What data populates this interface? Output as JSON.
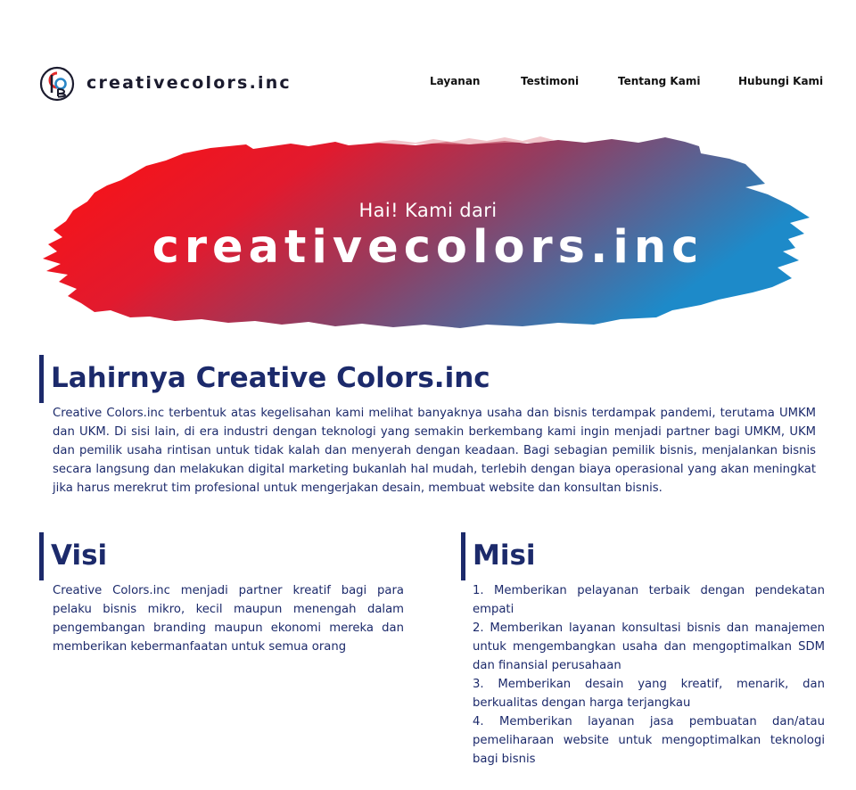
{
  "header": {
    "logo_icon": "creativecolors-logo-icon",
    "brand": "creativecolors.inc",
    "nav": [
      "Layanan",
      "Testimoni",
      "Tentang Kami",
      "Hubungi Kami"
    ]
  },
  "hero": {
    "subtitle": "Hai! Kami dari",
    "title": "creativecolors.inc",
    "gradient": [
      "#ff1010",
      "#1d8ac9"
    ]
  },
  "about": {
    "heading": "Lahirnya Creative Colors.inc",
    "body": "Creative Colors.inc terbentuk atas kegelisahan kami melihat banyaknya usaha dan bisnis terdampak pandemi, terutama UMKM dan UKM. Di sisi lain, di era industri dengan teknologi yang semakin berkembang kami ingin menjadi partner bagi UMKM, UKM dan pemilik usaha rintisan untuk tidak kalah dan menyerah dengan keadaan. Bagi sebagian pemilik bisnis, menjalankan bisnis secara langsung dan melakukan digital marketing bukanlah hal mudah, terlebih dengan biaya operasional yang akan meningkat jika harus merekrut tim profesional untuk mengerjakan desain, membuat website dan konsultan bisnis."
  },
  "visi": {
    "heading": "Visi",
    "body": "Creative Colors.inc menjadi partner kreatif bagi para pelaku bisnis mikro, kecil maupun menengah dalam pengembangan branding maupun ekonomi mereka dan memberikan kebermanfaatan untuk semua orang"
  },
  "misi": {
    "heading": "Misi",
    "items": [
      "1. Memberikan pelayanan terbaik dengan pendekatan empati",
      "2. Memberikan layanan konsultasi bisnis dan manajemen untuk mengembangkan usaha dan mengoptimalkan SDM dan finansial perusahaan",
      "3. Memberikan desain yang kreatif, menarik, dan berkualitas dengan harga terjangkau",
      "4. Memberikan layanan jasa pembuatan dan/atau pemeliharaan website untuk mengoptimalkan teknologi bagi bisnis"
    ]
  },
  "colors": {
    "navy": "#1c2a6b",
    "brand_red": "#e32b2b",
    "brand_blue": "#2a86c6"
  }
}
